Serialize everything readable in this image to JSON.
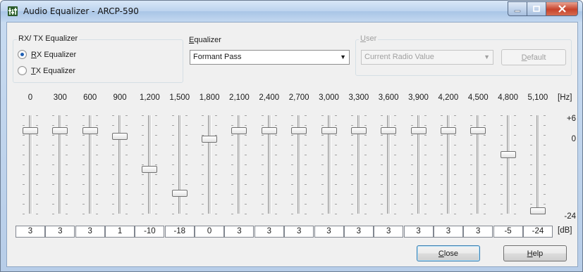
{
  "window": {
    "title": "Audio Equalizer - ARCP-590",
    "icon": "equalizer-app-icon",
    "controls": [
      "minimize-icon",
      "maximize-icon",
      "close-icon"
    ]
  },
  "rxtx_group": {
    "label": "RX/ TX Equalizer",
    "options": [
      {
        "mnemonic": "R",
        "label_rest": "X Equalizer",
        "checked": true
      },
      {
        "mnemonic": "T",
        "label_rest": "X Equalizer",
        "checked": false
      }
    ]
  },
  "equalizer_group": {
    "label_mnemonic": "E",
    "label_rest": "qualizer",
    "selected": "Formant Pass"
  },
  "user_group": {
    "label_mnemonic": "U",
    "label_rest": "ser",
    "selected": "Current Radio Value",
    "default_mnemonic": "D",
    "default_rest": "efault",
    "disabled": true
  },
  "bands": [
    {
      "freq": "0",
      "value": "3"
    },
    {
      "freq": "300",
      "value": "3"
    },
    {
      "freq": "600",
      "value": "3"
    },
    {
      "freq": "900",
      "value": "1"
    },
    {
      "freq": "1,200",
      "value": "-10"
    },
    {
      "freq": "1,500",
      "value": "-18"
    },
    {
      "freq": "1,800",
      "value": "0"
    },
    {
      "freq": "2,100",
      "value": "3"
    },
    {
      "freq": "2,400",
      "value": "3"
    },
    {
      "freq": "2,700",
      "value": "3"
    },
    {
      "freq": "3,000",
      "value": "3"
    },
    {
      "freq": "3,300",
      "value": "3"
    },
    {
      "freq": "3,600",
      "value": "3"
    },
    {
      "freq": "3,900",
      "value": "3"
    },
    {
      "freq": "4,200",
      "value": "3"
    },
    {
      "freq": "4,500",
      "value": "3"
    },
    {
      "freq": "4,800",
      "value": "-5"
    },
    {
      "freq": "5,100",
      "value": "-24"
    }
  ],
  "scale": {
    "freq_unit": "[Hz]",
    "db_unit": "[dB]",
    "top": "+6",
    "middle": "0",
    "bottom": "-24",
    "max": 6,
    "min": -24
  },
  "buttons": {
    "close_mnemonic": "C",
    "close_rest": "lose",
    "help_mnemonic": "H",
    "help_rest": "elp"
  }
}
